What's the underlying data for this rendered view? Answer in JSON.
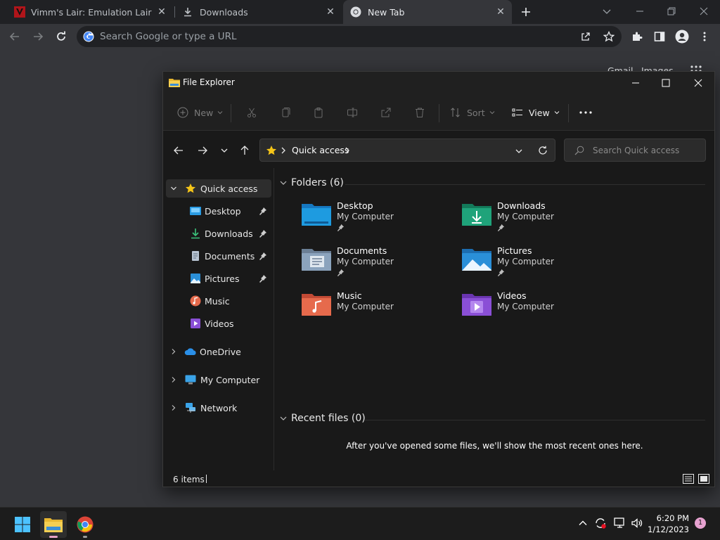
{
  "browser": {
    "tabs": [
      {
        "title": "Vimm's Lair: Emulation Lair",
        "icon": "vimm-logo-icon"
      },
      {
        "title": "Downloads",
        "icon": "download-icon"
      },
      {
        "title": "New Tab",
        "icon": "chrome-icon",
        "active": true
      }
    ],
    "omnibox_placeholder": "Search Google or type a URL",
    "ntp_links": {
      "gmail": "Gmail",
      "images": "Images"
    }
  },
  "explorer": {
    "window_title": "File Explorer",
    "commands": {
      "new": "New",
      "sort": "Sort",
      "view": "View"
    },
    "breadcrumb": "Quick access",
    "search_placeholder": "Search Quick access",
    "sidebar": [
      {
        "label": "Quick access",
        "icon": "star-icon",
        "expanded": true,
        "selected": true
      },
      {
        "label": "Desktop",
        "icon": "desktop-folder-icon",
        "pinned": true
      },
      {
        "label": "Downloads",
        "icon": "download-icon",
        "pinned": true
      },
      {
        "label": "Documents",
        "icon": "documents-icon",
        "pinned": true
      },
      {
        "label": "Pictures",
        "icon": "pictures-icon",
        "pinned": true
      },
      {
        "label": "Music",
        "icon": "music-icon"
      },
      {
        "label": "Videos",
        "icon": "videos-icon"
      },
      {
        "label": "OneDrive",
        "icon": "cloud-icon"
      },
      {
        "label": "My Computer",
        "icon": "computer-icon"
      },
      {
        "label": "Network",
        "icon": "network-icon"
      }
    ],
    "folders_heading": "Folders (6)",
    "folders": [
      {
        "name": "Desktop",
        "location": "My Computer",
        "pinned": true,
        "color": "#1e9be0"
      },
      {
        "name": "Downloads",
        "location": "My Computer",
        "pinned": true,
        "color": "#1fa37a"
      },
      {
        "name": "Documents",
        "location": "My Computer",
        "pinned": true,
        "color": "#8ba3bd"
      },
      {
        "name": "Pictures",
        "location": "My Computer",
        "pinned": true,
        "color": "#2a8fd8"
      },
      {
        "name": "Music",
        "location": "My Computer",
        "pinned": false,
        "color": "#e66a4c"
      },
      {
        "name": "Videos",
        "location": "My Computer",
        "pinned": false,
        "color": "#8a4fd6"
      }
    ],
    "recent_heading": "Recent files (0)",
    "recent_empty_text": "After you've opened some files, we'll show the most recent ones here.",
    "status_items": "6 items"
  },
  "taskbar": {
    "time": "6:20 PM",
    "date": "1/12/2023",
    "notification_count": "1"
  }
}
